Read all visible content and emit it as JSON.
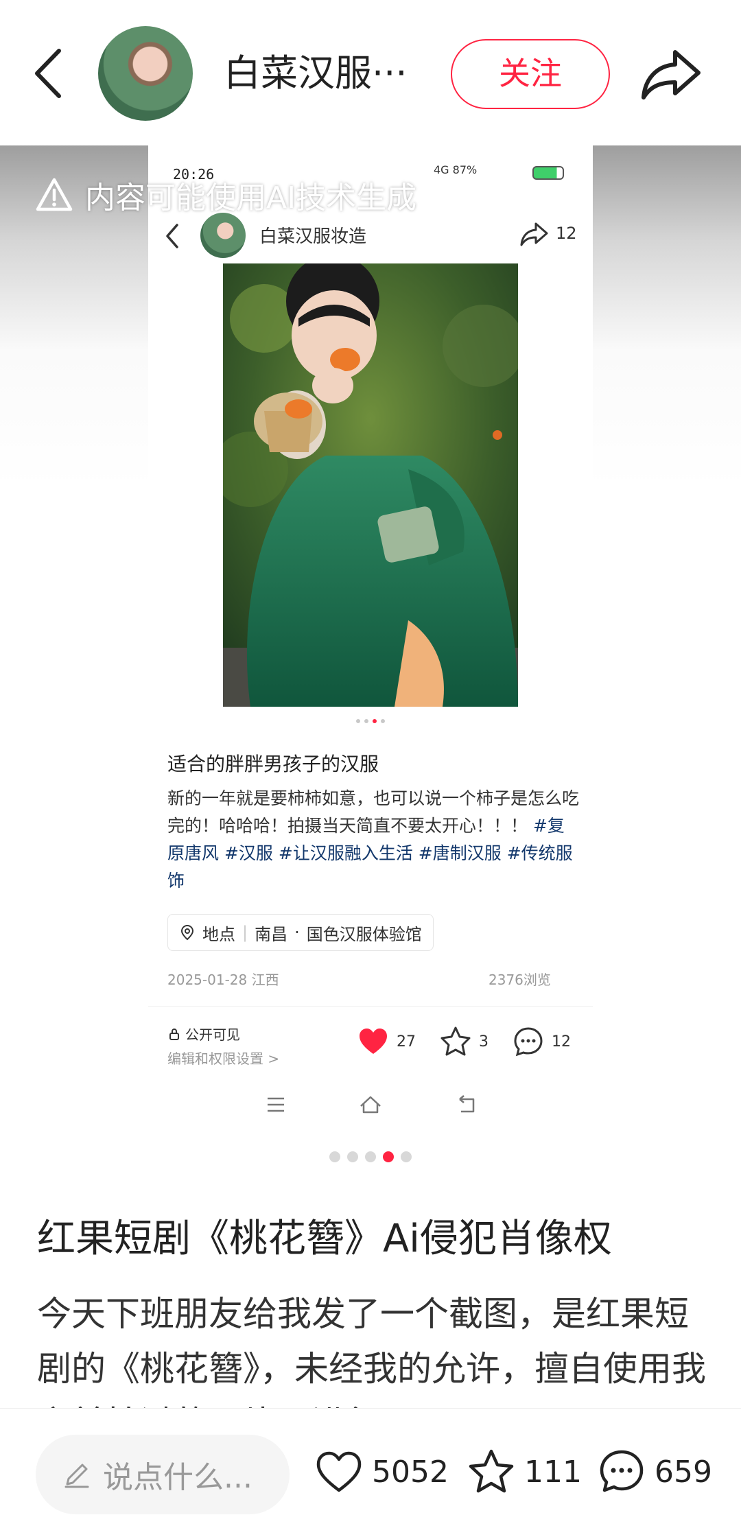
{
  "nav": {
    "author_name": "白菜汉服···",
    "follow_label": "关注"
  },
  "ai_notice": "内容可能使用AI技术生成",
  "embedded_screenshot": {
    "status_time": "20:26",
    "status_icons": "4G 87%",
    "author_name": "白菜汉服妆造",
    "share_count": "12",
    "title": "适合的胖胖男孩子的汉服",
    "body_text": "新的一年就是要柿柿如意，也可以说一个柿子是怎么吃完的！哈哈哈！拍摄当天简直不要太开心！！！",
    "tags": [
      "#复原唐风",
      "#汉服",
      "#让汉服融入生活",
      "#唐制汉服",
      "#传统服饰"
    ],
    "location_label": "地点",
    "location_city": "南昌",
    "location_place": "国色汉服体验馆",
    "date": "2025-01-28 江西",
    "views": "2376浏览",
    "privacy_label": "公开可见",
    "privacy_edit": "编辑和权限设置 >",
    "like_count": "27",
    "collect_count": "3",
    "comment_count": "12",
    "carousel_total": 4,
    "carousel_active": 3
  },
  "carousel": {
    "total": 5,
    "active": 4
  },
  "post": {
    "title": "红果短剧《桃花簪》Ai侵犯肖像权",
    "body": "今天下班朋友给我发了一个截图，是红果短剧的《桃花簪》，未经我的允许，擅自使用我之前拍过的照片，进行Ai"
  },
  "bottom_bar": {
    "comment_placeholder": "说点什么...",
    "likes": "5052",
    "collects": "111",
    "comments": "659"
  },
  "colors": {
    "accent": "#ff2442",
    "tag_link": "#13386c"
  },
  "icons": [
    "back-icon",
    "share-icon",
    "warning-icon",
    "heart-icon",
    "star-icon",
    "comment-icon",
    "pencil-icon",
    "location-icon",
    "lock-icon"
  ]
}
